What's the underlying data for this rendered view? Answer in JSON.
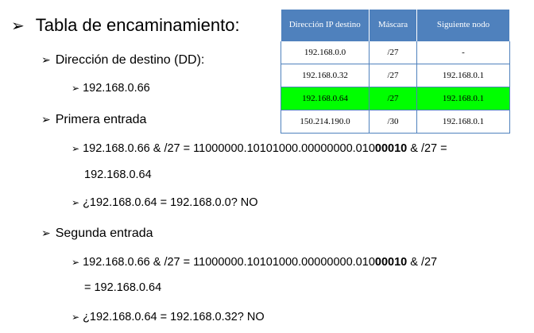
{
  "bullets": {
    "arrow": "➢",
    "title": "Tabla de encaminamiento:",
    "dd_heading": "Dirección de destino (DD):",
    "dd_value": "192.168.0.66",
    "entry1_heading": "Primera entrada",
    "entry1_calc_pre": "192.168.0.66 & /27  = 11000000.10101000.00000000.010",
    "entry1_calc_bold": "00010",
    "entry1_calc_post": " & /27  =",
    "entry1_result": "192.168.0.64",
    "entry1_check": "¿192.168.0.64 = 192.168.0.0?  NO",
    "entry2_heading": "Segunda entrada",
    "entry2_calc_pre": "192.168.0.66  & /27  = 11000000.10101000.00000000.010",
    "entry2_calc_bold": "00010",
    "entry2_calc_post": " & /27",
    "entry2_result": "= 192.168.0.64",
    "entry2_check": "¿192.168.0.64 = 192.168.0.32?  NO"
  },
  "table": {
    "headers": [
      "Dirección IP destino",
      "Máscara",
      "Siguiente nodo"
    ],
    "rows": [
      [
        "192.168.0.0",
        "/27",
        "-"
      ],
      [
        "192.168.0.32",
        "/27",
        "192.168.0.1"
      ],
      [
        "192.168.0.64",
        "/27",
        "192.168.0.1"
      ],
      [
        "150.214.190.0",
        "/30",
        "192.168.0.1"
      ]
    ],
    "highlight_row_index": 2,
    "header_color": "#4f81bd",
    "highlight_color": "#00ff00"
  }
}
